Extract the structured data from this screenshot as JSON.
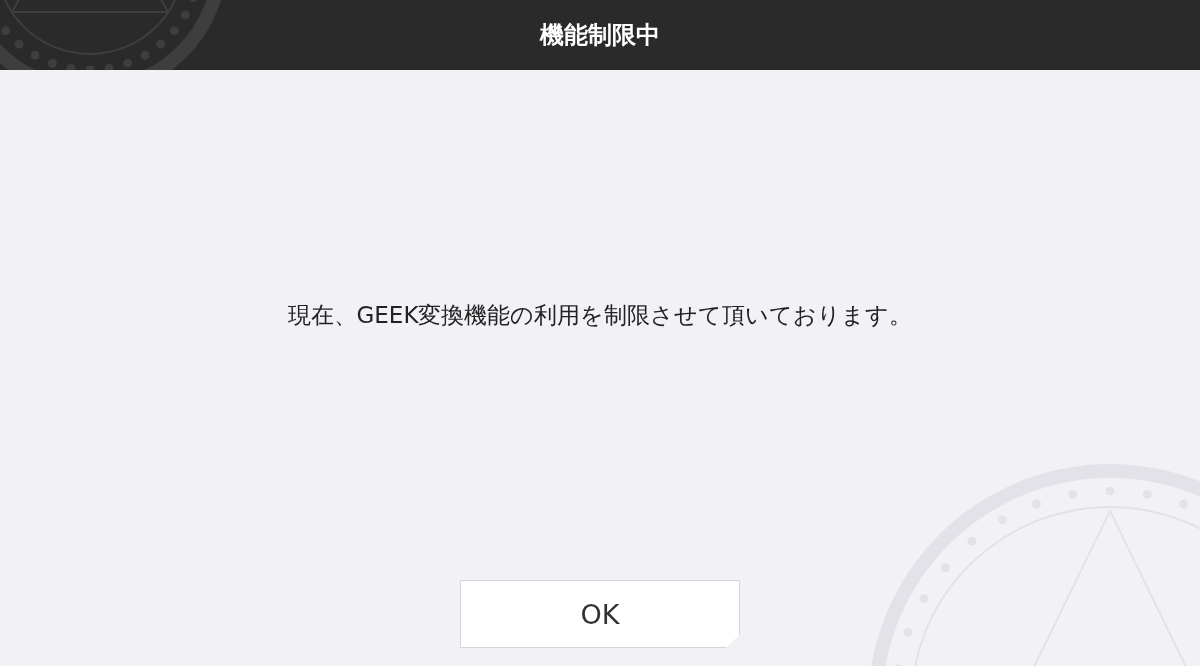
{
  "dialog": {
    "title": "機能制限中",
    "message": "現在、GEEK変換機能の利用を制限させて頂いております。",
    "buttons": [
      "OK"
    ]
  }
}
